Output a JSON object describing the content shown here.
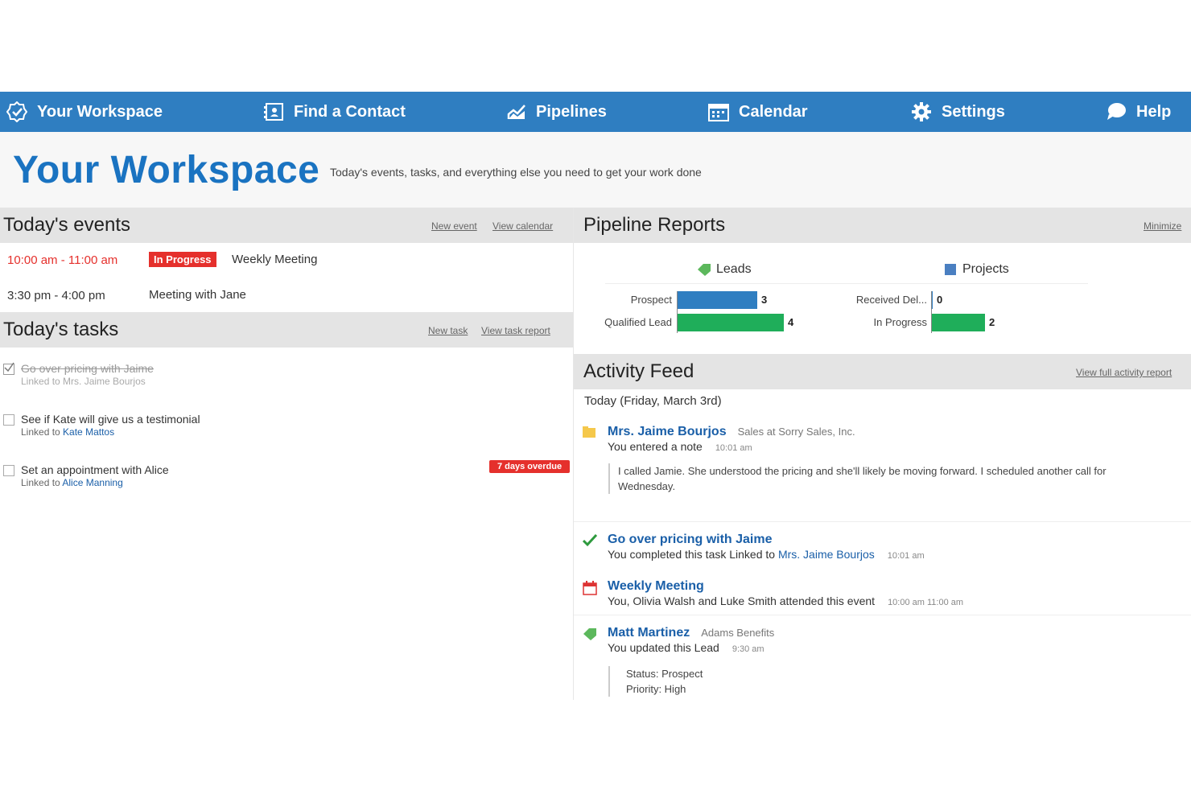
{
  "nav": {
    "workspace": "Your Workspace",
    "find_contact": "Find a Contact",
    "pipelines": "Pipelines",
    "calendar": "Calendar",
    "settings": "Settings",
    "help": "Help"
  },
  "header": {
    "title": "Your Workspace",
    "subtitle": "Today's events, tasks, and everything else you need to get your work done"
  },
  "events": {
    "title": "Today's events",
    "new_event": "New event",
    "view_calendar": "View calendar",
    "items": [
      {
        "time": "10:00 am - 11:00 am",
        "badge": "In Progress",
        "name": "Weekly Meeting"
      },
      {
        "time": "3:30 pm - 4:00 pm",
        "name": "Meeting with Jane"
      }
    ]
  },
  "tasks": {
    "title": "Today's tasks",
    "new_task": "New task",
    "view_all": "View task report",
    "items": [
      {
        "title": "Go over pricing with Jaime",
        "linked_prefix": "Linked to",
        "linked": "Mrs. Jaime Bourjos",
        "done": true
      },
      {
        "title": "See if Kate will give us a testimonial",
        "linked_prefix": "Linked to",
        "linked": "Kate Mattos",
        "done": false
      },
      {
        "title": "Set an appointment with Alice",
        "linked_prefix": "Linked to",
        "linked": "Alice Manning",
        "done": false,
        "overdue": "7 days overdue"
      }
    ]
  },
  "pipeline": {
    "title": "Pipeline Reports",
    "minimize": "Minimize",
    "leads_label": "Leads",
    "projects_label": "Projects",
    "colors": {
      "blue": "#2f7ec1",
      "green": "#1fae5a",
      "leads_icon": "#5cb85c",
      "projects_icon": "#4a7fc1"
    }
  },
  "chart_data": [
    {
      "type": "bar",
      "title": "Leads",
      "categories": [
        "Prospect",
        "Qualified Lead"
      ],
      "values": [
        3,
        4
      ],
      "colors": [
        "#2f7ec1",
        "#1fae5a"
      ]
    },
    {
      "type": "bar",
      "title": "Projects",
      "categories": [
        "Received Del...",
        "In Progress"
      ],
      "values": [
        0,
        2
      ],
      "colors": [
        "#2f7ec1",
        "#1fae5a"
      ]
    }
  ],
  "feed": {
    "title": "Activity Feed",
    "view_all": "View full activity report",
    "date": "Today (Friday, March 3rd)",
    "items": [
      {
        "title": "Mrs. Jaime Bourjos",
        "sub": "Sales at Sorry Sales, Inc.",
        "line": "You entered a note",
        "time": "10:01 am",
        "quote": "I called Jamie. She understood the pricing and she'll likely be moving forward. I scheduled another call for Wednesday."
      },
      {
        "title": "Go over pricing with Jaime",
        "line": "You completed this task Linked to",
        "link": "Mrs. Jaime Bourjos",
        "time": "10:01 am"
      },
      {
        "title": "Weekly Meeting",
        "line": "You, Olivia Walsh and Luke Smith attended this event",
        "time": "10:00 am  11:00 am"
      },
      {
        "title": "Matt Martinez",
        "sub": "Adams Benefits",
        "line": "You updated this Lead",
        "time": "9:30 am",
        "quote_status": "Status: Prospect",
        "quote_priority": "Priority: High"
      }
    ]
  }
}
